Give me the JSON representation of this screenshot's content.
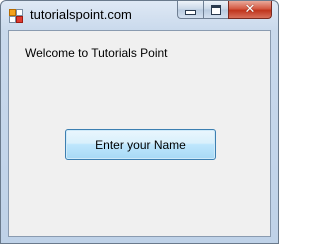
{
  "window": {
    "title": "tutorialspoint.com",
    "minimize_icon": "minimize-icon",
    "maximize_icon": "maximize-icon",
    "close_icon": "close-icon",
    "close_glyph": "✕",
    "app_icon": "form-app-icon"
  },
  "form": {
    "welcome_label": "Welcome to Tutorials Point",
    "enter_name_button": "Enter your Name"
  },
  "colors": {
    "title_bar": "#c9d9ec",
    "client_background": "#f0f0f0",
    "close_button": "#c0341c",
    "button_border": "#3c7fb1"
  }
}
